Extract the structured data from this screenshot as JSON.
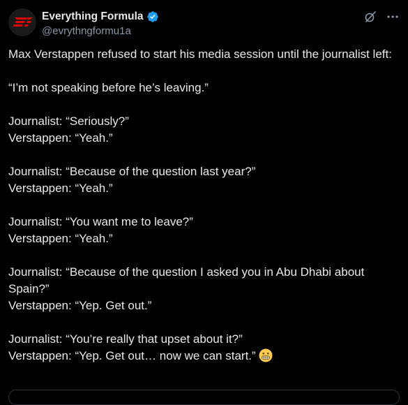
{
  "author": {
    "display_name": "Everything Formula",
    "handle": "@evrythngformu1a",
    "verified_color": "#1d9bf0",
    "avatar_icon": "everything-formula-logo",
    "avatar_color": "#e10600"
  },
  "actions": {
    "grok_icon": "grok-icon",
    "more_icon": "more-icon"
  },
  "tweet": {
    "intro": "Max Verstappen refused to start his media session until the journalist left:",
    "quote": "“I’m not speaking before he’s leaving.”",
    "exchanges": [
      {
        "journalist": "Journalist: “Seriously?”",
        "verstappen": "Verstappen: “Yeah.”"
      },
      {
        "journalist": "Journalist: “Because of the question last year?”",
        "verstappen": "Verstappen: “Yeah.”"
      },
      {
        "journalist": "Journalist: “You want me to leave?”",
        "verstappen": "Verstappen: “Yeah.”"
      },
      {
        "journalist": "Journalist: “Because of the question I asked you in Abu Dhabi about Spain?”",
        "verstappen": "Verstappen: “Yep. Get out.”"
      },
      {
        "journalist": "Journalist: “You’re really that upset about it?”",
        "verstappen": "Verstappen: “Yep. Get out… now we can start.”"
      }
    ],
    "final_emoji": "grimacing-face-emoji"
  },
  "colors": {
    "background": "#000000",
    "text": "#e7e9ea",
    "secondary_text": "#8b98a5",
    "accent": "#1d9bf0",
    "border": "#2f3336"
  }
}
